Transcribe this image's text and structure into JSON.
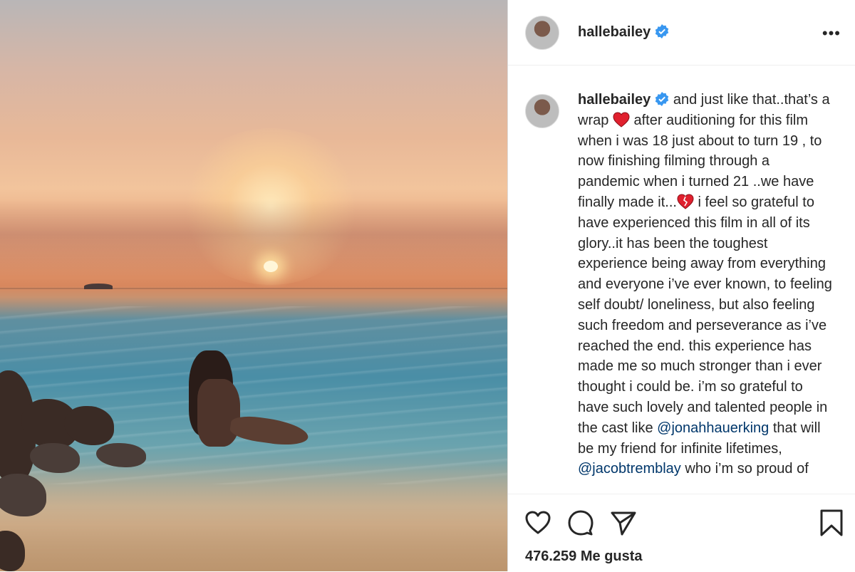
{
  "post": {
    "username": "hallebailey",
    "caption_segments": [
      {
        "type": "text",
        "value": " and just like that..that’s a wrap "
      },
      {
        "type": "emoji",
        "value": "heart"
      },
      {
        "type": "text",
        "value": " after auditioning for this film when i was 18 just about to turn 19 , to now finishing filming through a pandemic when i turned 21 ..we have finally made it..."
      },
      {
        "type": "emoji",
        "value": "heart-broken"
      },
      {
        "type": "text",
        "value": " i feel so grateful to have experienced this film in all of its glory..it has been the toughest experience being away from everything and everyone i’ve ever known, to feeling self doubt/ loneliness, but also feeling such freedom and perseverance as i’ve reached the end. this experience has made me so much stronger than i ever thought i could be. i’m so grateful to have such lovely and talented people in the cast like "
      },
      {
        "type": "mention",
        "value": "@jonahhauerking"
      },
      {
        "type": "text",
        "value": " that will be my friend for infinite lifetimes, "
      },
      {
        "type": "mention",
        "value": "@jacobtremblay"
      },
      {
        "type": "text",
        "value": " who i’m so proud of"
      }
    ],
    "likes_text": "476.259 Me gusta"
  },
  "icons": {
    "more": "more-options-icon",
    "like": "heart-outline-icon",
    "comment": "comment-icon",
    "share": "paper-plane-icon",
    "save": "bookmark-icon",
    "verified": "verified-badge-icon"
  },
  "colors": {
    "verified_blue": "#3897f0",
    "mention": "#00376b",
    "text": "#262626"
  }
}
